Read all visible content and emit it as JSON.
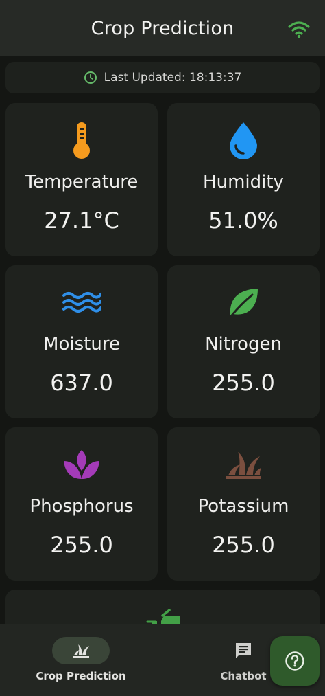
{
  "appbar": {
    "title": "Crop Prediction",
    "wifi_icon": "wifi-icon",
    "wifi_color": "#4caf50"
  },
  "status": {
    "icon": "clock-icon",
    "icon_color": "#66bb6a",
    "label": "Last Updated: 18:13:37"
  },
  "cards": [
    {
      "icon": "thermometer-icon",
      "icon_color": "#f59b1e",
      "label": "Temperature",
      "value": "27.1°C"
    },
    {
      "icon": "water-drop-icon",
      "icon_color": "#2196f3",
      "label": "Humidity",
      "value": "51.0%"
    },
    {
      "icon": "waves-icon",
      "icon_color": "#2f8fe8",
      "label": "Moisture",
      "value": "637.0"
    },
    {
      "icon": "leaf-icon",
      "icon_color": "#4caf50",
      "label": "Nitrogen",
      "value": "255.0"
    },
    {
      "icon": "lotus-icon",
      "icon_color": "#a43bb8",
      "label": "Phosphorus",
      "value": "255.0"
    },
    {
      "icon": "grass-icon",
      "icon_color": "#7b4f3f",
      "label": "Potassium",
      "value": "255.0"
    }
  ],
  "partial_card": {
    "icon": "agriculture-icon",
    "icon_color": "#43a047"
  },
  "nav": {
    "crop_label": "Crop Prediction",
    "crop_icon": "grass-icon",
    "chat_label": "Chatbot",
    "chat_icon": "chat-icon"
  },
  "fab": {
    "icon": "help-icon"
  }
}
